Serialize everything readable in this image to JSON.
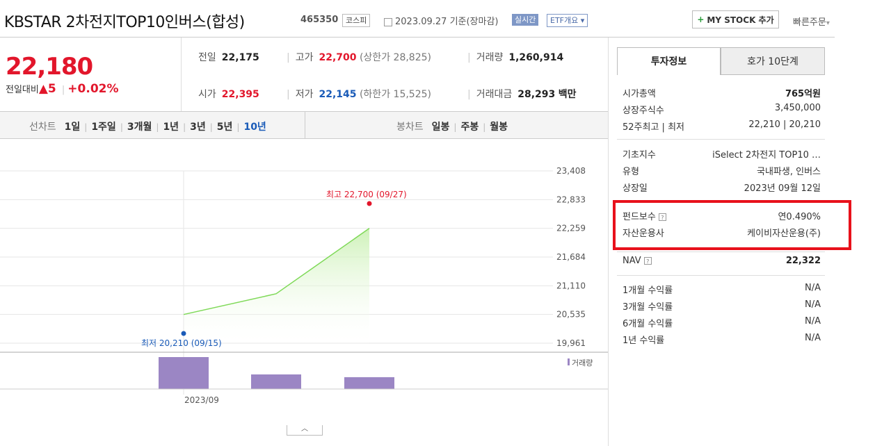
{
  "header": {
    "title": "KBSTAR 2차전지TOP10인버스(합성)",
    "code": "465350",
    "market": "코스피",
    "date": "2023.09.27  기준(장마감)",
    "live_label": "실시간",
    "etf_label": "ETF개요",
    "my_stock_label": "MY STOCK 추가",
    "quick_order_label": "빠른주문"
  },
  "price": {
    "current": "22,180",
    "change_label": "전일대비",
    "change_value": "5",
    "change_pct": "+0.02%"
  },
  "market": {
    "prev_label": "전일",
    "prev": "22,175",
    "high_label": "고가",
    "high": "22,700",
    "upper_label": "(상한가",
    "upper": "28,825)",
    "vol_label": "거래량",
    "vol": "1,260,914",
    "open_label": "시가",
    "open": "22,395",
    "low_label": "저가",
    "low": "22,145",
    "lower_label": "(하한가",
    "lower": "15,525)",
    "amt_label": "거래대금",
    "amt": "28,293",
    "amt_unit": "백만"
  },
  "tabs": {
    "line_label": "선차트",
    "line_periods": [
      "1일",
      "1주일",
      "3개월",
      "1년",
      "3년",
      "5년",
      "10년"
    ],
    "candle_label": "봉차트",
    "candle_periods": [
      "일봉",
      "주봉",
      "월봉"
    ]
  },
  "chart_data": {
    "type": "area",
    "x": [
      "2023-09-15",
      "2023-09-22",
      "2023-09-27"
    ],
    "y": [
      20535,
      20950,
      22259
    ],
    "volume": [
      3.5,
      1.6,
      1.3
    ],
    "yticks": [
      "23,408",
      "22,833",
      "22,259",
      "21,684",
      "21,110",
      "20,535",
      "19,961"
    ],
    "ylim": [
      19961,
      23408
    ],
    "max_label": "최고 22,700 (09/27)",
    "min_label": "최저 20,210 (09/15)",
    "volume_legend": "거래량",
    "xtick": "2023/09",
    "line_color": "#7ed957",
    "volume_color": "#9b86c4"
  },
  "right": {
    "tab_invest": "투자정보",
    "tab_quote": "호가 10단계",
    "rows1": [
      {
        "k": "시가총액",
        "v": "765억원"
      },
      {
        "k": "상장주식수",
        "v": "3,450,000"
      },
      {
        "k": "52주최고 | 최저",
        "v": "22,210 | 20,210"
      }
    ],
    "rows2": [
      {
        "k": "기초지수",
        "v": "iSelect 2차전지 TOP10 …"
      },
      {
        "k": "유형",
        "v": "국내파생, 인버스"
      },
      {
        "k": "상장일",
        "v": "2023년 09월 12일"
      }
    ],
    "fee_label": "펀드보수",
    "fee_value": "연0.490%",
    "manager_label": "자산운용사",
    "manager_value": "케이비자산운용(주)",
    "nav_label": "NAV",
    "nav_value": "22,322",
    "rows3": [
      {
        "k": "1개월 수익률",
        "v": "N/A"
      },
      {
        "k": "3개월 수익률",
        "v": "N/A"
      },
      {
        "k": "6개월 수익률",
        "v": "N/A"
      },
      {
        "k": "1년 수익률",
        "v": "N/A"
      }
    ]
  }
}
